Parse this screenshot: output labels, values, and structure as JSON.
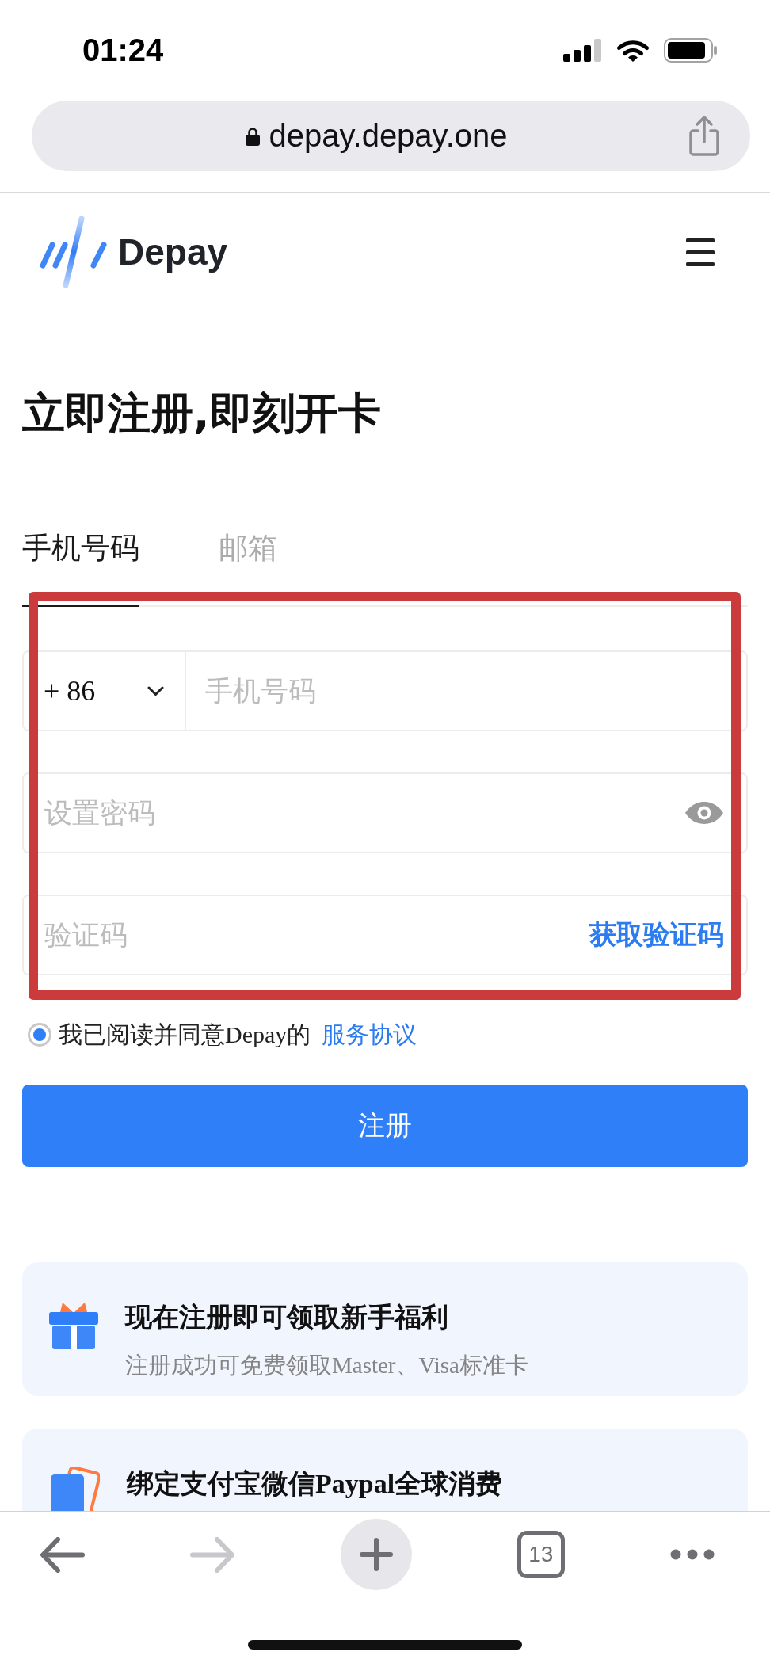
{
  "status_bar": {
    "time": "01:24"
  },
  "address_bar": {
    "url": "depay.depay.one"
  },
  "header": {
    "logo_text": "Depay"
  },
  "title": "立即注册,即刻开卡",
  "tabs": [
    {
      "label": "手机号码",
      "selected": true
    },
    {
      "label": "邮箱",
      "selected": false
    }
  ],
  "form": {
    "country_code": "+ 86",
    "phone": {
      "placeholder": "手机号码"
    },
    "password": {
      "placeholder": "设置密码"
    },
    "code": {
      "placeholder": "验证码",
      "action": "获取验证码"
    }
  },
  "agreement": {
    "checked": true,
    "text": "我已阅读并同意Depay的",
    "link": "服务协议"
  },
  "submit": {
    "label": "注册"
  },
  "benefits": [
    {
      "kind": "gift",
      "title": "现在注册即可领取新手福利",
      "subtitle": "注册成功可免费领取Master、Visa标准卡"
    },
    {
      "kind": "card",
      "title": "绑定支付宝微信Paypal全球消费"
    }
  ],
  "toolbar": {
    "buttons": [
      {
        "kind": "back",
        "disabled": false
      },
      {
        "kind": "forward",
        "disabled": true
      },
      {
        "kind": "new_tab",
        "disabled": false
      },
      {
        "kind": "tabs",
        "label": "13",
        "disabled": false
      },
      {
        "kind": "more",
        "disabled": false
      }
    ]
  }
}
